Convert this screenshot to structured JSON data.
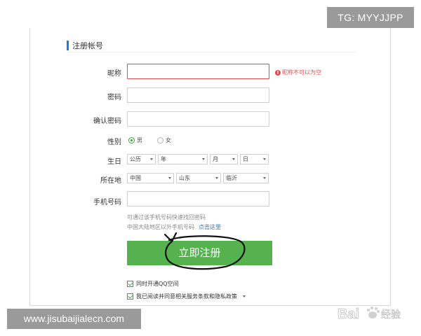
{
  "watermarks": {
    "top": "TG: MYYJJPP",
    "bottom": "www.jisubaijialecn.com"
  },
  "section": {
    "title": "注册帐号"
  },
  "form": {
    "nickname": {
      "label": "昵称",
      "value": "",
      "error": "昵称不可以为空",
      "error_icon": "exclamation-icon"
    },
    "password": {
      "label": "密码",
      "value": ""
    },
    "confirm_password": {
      "label": "确认密码",
      "value": ""
    },
    "gender": {
      "label": "性别",
      "options": [
        {
          "label": "男",
          "selected": true
        },
        {
          "label": "女",
          "selected": false
        }
      ]
    },
    "birthday": {
      "label": "生日",
      "calendar": "公历",
      "year": "年",
      "month": "月",
      "day": "日"
    },
    "location": {
      "label": "所在地",
      "country": "中国",
      "province": "山东",
      "city": "临沂"
    },
    "phone": {
      "label": "手机号码",
      "value": "",
      "hint1": "可通过该手机号码快速找回密码",
      "hint2": "中国大陆地区以外手机号码",
      "hint2_link": "点击这里"
    }
  },
  "submit_label": "立即注册",
  "agreements": [
    {
      "label": "同时开通QQ空间",
      "checked": true
    },
    {
      "label": "我已阅读并同意相关服务条款和隐私政策",
      "checked": true
    }
  ],
  "logo": {
    "text": "Bai",
    "icon": "baidu-paw-icon",
    "suffix": "经验"
  },
  "colors": {
    "accent": "#55b24e",
    "error": "#e24b4b",
    "link": "#2a78d0"
  }
}
